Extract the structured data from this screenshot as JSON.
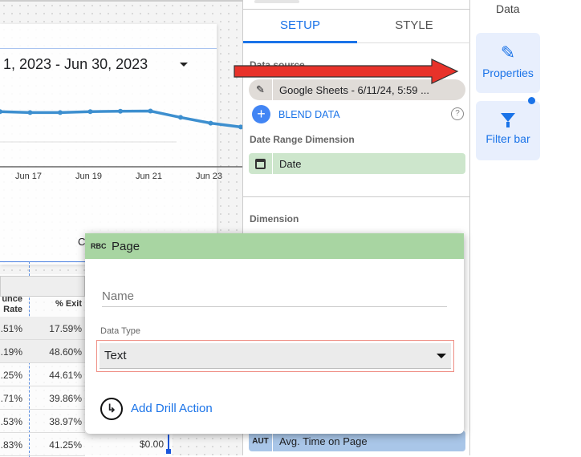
{
  "canvas": {
    "date_range": "1, 2023 - Jun 30, 2023",
    "x_ticks": [
      "Jun 17",
      "Jun 19",
      "Jun 21",
      "Jun 23"
    ],
    "chart_series": [
      0.45,
      0.5,
      0.5,
      0.45,
      0.43,
      0.42,
      0.75,
      1.05,
      1.25
    ],
    "partial_label": "C",
    "table": {
      "headers": [
        "unce Rate",
        "% Exit"
      ],
      "rows": [
        [
          ".51%",
          "17.59%"
        ],
        [
          ".19%",
          "48.60%"
        ],
        [
          ".25%",
          "44.61%"
        ],
        [
          ".71%",
          "39.86%"
        ],
        [
          ".53%",
          "38.97%"
        ],
        [
          ".83%",
          "41.25%"
        ]
      ],
      "extra_value": "$0.00"
    }
  },
  "panel": {
    "tabs": [
      {
        "label": "SETUP",
        "active": true
      },
      {
        "label": "STYLE",
        "active": false
      }
    ],
    "data_source_label": "Data source",
    "data_source_value": "Google Sheets - 6/11/24, 5:59 ...",
    "blend_label": "BLEND DATA",
    "date_range_dim_label": "Date Range Dimension",
    "date_range_dim_value": "Date",
    "dimension_label": "Dimension",
    "metric_type": "AUT",
    "metric_value": "Avg. Time on Page"
  },
  "right": {
    "title": "Data",
    "properties": "Properties",
    "filter_bar": "Filter bar"
  },
  "popup": {
    "type_badge": "RBC",
    "field_name": "Page",
    "name_placeholder": "Name",
    "data_type_label": "Data Type",
    "data_type_value": "Text",
    "drill_action": "Add Drill Action"
  },
  "colors": {
    "accent": "#1a73e8",
    "dimension": "#cde6cc",
    "header_green": "#a8d5a2",
    "metric": "#a9c6e8",
    "arrow": "#e8322a"
  }
}
